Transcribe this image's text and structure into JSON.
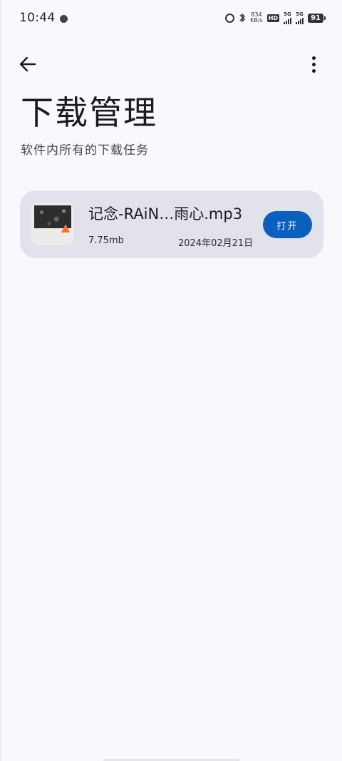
{
  "status_bar": {
    "time": "10:44",
    "net_speed_value": "834",
    "net_speed_unit": "KB/s",
    "hd_label": "HD",
    "sim1_label": "5G",
    "sim2_label": "5G",
    "battery": "91"
  },
  "header": {
    "title": "下载管理",
    "subtitle": "软件内所有的下载任务"
  },
  "downloads": [
    {
      "name": "记念-RAiN…雨心.mp3",
      "size": "7.75mb",
      "date": "2024年02月21日",
      "action_label": "打开"
    }
  ],
  "colors": {
    "background": "#fbf8fd",
    "card": "#e1e2ec",
    "accent_button": "#0b5fbd"
  }
}
